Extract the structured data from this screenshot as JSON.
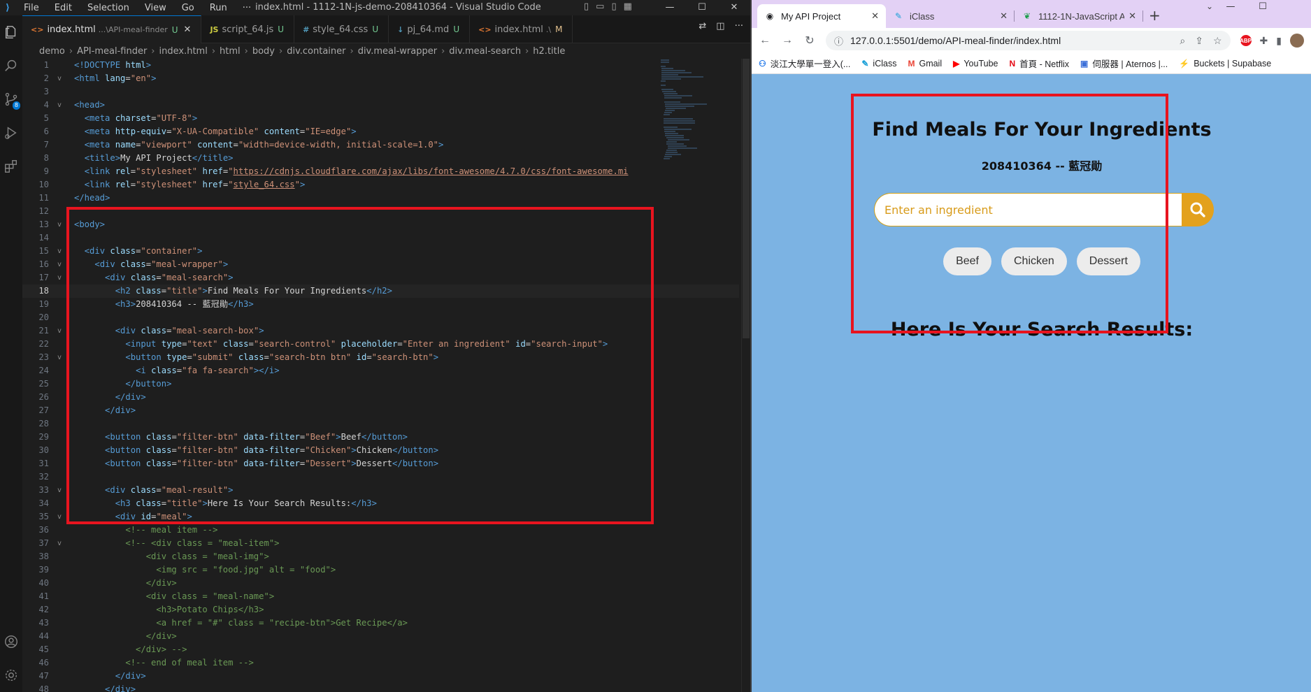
{
  "vscode": {
    "logo": "⟩",
    "menu": [
      "File",
      "Edit",
      "Selection",
      "View",
      "Go",
      "Run",
      "···"
    ],
    "window_title": "index.html - 1112-1N-js-demo-208410364 - Visual Studio Code",
    "source_control_badge": "8",
    "tabs": [
      {
        "icon": "<>",
        "label": "index.html",
        "desc": "...\\API-meal-finder",
        "status": "U",
        "kind": "html",
        "active": true
      },
      {
        "icon": "JS",
        "label": "script_64.js",
        "desc": "",
        "status": "U",
        "kind": "js",
        "active": false
      },
      {
        "icon": "#",
        "label": "style_64.css",
        "desc": "",
        "status": "U",
        "kind": "css",
        "active": false
      },
      {
        "icon": "↓",
        "label": "pj_64.md",
        "desc": "",
        "status": "U",
        "kind": "md",
        "active": false
      },
      {
        "icon": "<>",
        "label": "index.html",
        "desc": ".\\",
        "status": "M",
        "kind": "html",
        "active": false
      }
    ],
    "breadcrumb": [
      "demo",
      "API-meal-finder",
      "index.html",
      "html",
      "body",
      "div.container",
      "div.meal-wrapper",
      "div.meal-search",
      "h2.title"
    ],
    "current_line": 18,
    "code_lines": [
      {
        "n": 1,
        "fold": "",
        "html": "<span class=\"t\">&lt;!DOCTYPE</span> <span class=\"a\">html</span><span class=\"t\">&gt;</span>"
      },
      {
        "n": 2,
        "fold": "v",
        "html": "<span class=\"t\">&lt;html</span> <span class=\"a\">lang</span>=<span class=\"s\">\"en\"</span><span class=\"t\">&gt;</span>"
      },
      {
        "n": 3,
        "fold": "",
        "html": ""
      },
      {
        "n": 4,
        "fold": "v",
        "html": "<span class=\"t\">&lt;head&gt;</span>"
      },
      {
        "n": 5,
        "fold": "",
        "html": "  <span class=\"t\">&lt;meta</span> <span class=\"a\">charset</span>=<span class=\"s\">\"UTF-8\"</span><span class=\"t\">&gt;</span>"
      },
      {
        "n": 6,
        "fold": "",
        "html": "  <span class=\"t\">&lt;meta</span> <span class=\"a\">http-equiv</span>=<span class=\"s\">\"X-UA-Compatible\"</span> <span class=\"a\">content</span>=<span class=\"s\">\"IE=edge\"</span><span class=\"t\">&gt;</span>"
      },
      {
        "n": 7,
        "fold": "",
        "html": "  <span class=\"t\">&lt;meta</span> <span class=\"a\">name</span>=<span class=\"s\">\"viewport\"</span> <span class=\"a\">content</span>=<span class=\"s\">\"width=device-width, initial-scale=1.0\"</span><span class=\"t\">&gt;</span>"
      },
      {
        "n": 8,
        "fold": "",
        "html": "  <span class=\"t\">&lt;title&gt;</span>My API Project<span class=\"t\">&lt;/title&gt;</span>"
      },
      {
        "n": 9,
        "fold": "",
        "html": "  <span class=\"t\">&lt;link</span> <span class=\"a\">rel</span>=<span class=\"s\">\"stylesheet\"</span> <span class=\"a\">href</span>=<span class=\"s\">\"<span class=\"u\">https://cdnjs.cloudflare.com/ajax/libs/font-awesome/4.7.0/css/font-awesome.mi</span></span>"
      },
      {
        "n": 10,
        "fold": "",
        "html": "  <span class=\"t\">&lt;link</span> <span class=\"a\">rel</span>=<span class=\"s\">\"stylesheet\"</span> <span class=\"a\">href</span>=<span class=\"s\">\"<span class=\"u\">style_64.css</span>\"</span><span class=\"t\">&gt;</span>"
      },
      {
        "n": 11,
        "fold": "",
        "html": "<span class=\"t\">&lt;/head&gt;</span>"
      },
      {
        "n": 12,
        "fold": "",
        "html": ""
      },
      {
        "n": 13,
        "fold": "v",
        "html": "<span class=\"t\">&lt;body&gt;</span>"
      },
      {
        "n": 14,
        "fold": "",
        "html": ""
      },
      {
        "n": 15,
        "fold": "v",
        "html": "  <span class=\"t\">&lt;div</span> <span class=\"a\">class</span>=<span class=\"s\">\"container\"</span><span class=\"t\">&gt;</span>"
      },
      {
        "n": 16,
        "fold": "v",
        "html": "    <span class=\"t\">&lt;div</span> <span class=\"a\">class</span>=<span class=\"s\">\"meal-wrapper\"</span><span class=\"t\">&gt;</span>"
      },
      {
        "n": 17,
        "fold": "v",
        "html": "      <span class=\"t\">&lt;div</span> <span class=\"a\">class</span>=<span class=\"s\">\"meal-search\"</span><span class=\"t\">&gt;</span>"
      },
      {
        "n": 18,
        "fold": "",
        "html": "        <span class=\"t\">&lt;h2</span> <span class=\"a\">class</span>=<span class=\"s\">\"title\"</span><span class=\"t\">&gt;</span>Find Meals For Your Ingredients<span class=\"t\">&lt;/h2&gt;</span>"
      },
      {
        "n": 19,
        "fold": "",
        "html": "        <span class=\"t\">&lt;h3&gt;</span>208410364 -- 藍冠勛<span class=\"t\">&lt;/h3&gt;</span>"
      },
      {
        "n": 20,
        "fold": "",
        "html": ""
      },
      {
        "n": 21,
        "fold": "v",
        "html": "        <span class=\"t\">&lt;div</span> <span class=\"a\">class</span>=<span class=\"s\">\"meal-search-box\"</span><span class=\"t\">&gt;</span>"
      },
      {
        "n": 22,
        "fold": "",
        "html": "          <span class=\"t\">&lt;input</span> <span class=\"a\">type</span>=<span class=\"s\">\"text\"</span> <span class=\"a\">class</span>=<span class=\"s\">\"search-control\"</span> <span class=\"a\">placeholder</span>=<span class=\"s\">\"Enter an ingredient\"</span> <span class=\"a\">id</span>=<span class=\"s\">\"search-input\"</span><span class=\"t\">&gt;</span>"
      },
      {
        "n": 23,
        "fold": "v",
        "html": "          <span class=\"t\">&lt;button</span> <span class=\"a\">type</span>=<span class=\"s\">\"submit\"</span> <span class=\"a\">class</span>=<span class=\"s\">\"search-btn btn\"</span> <span class=\"a\">id</span>=<span class=\"s\">\"search-btn\"</span><span class=\"t\">&gt;</span>"
      },
      {
        "n": 24,
        "fold": "",
        "html": "            <span class=\"t\">&lt;i</span> <span class=\"a\">class</span>=<span class=\"s\">\"fa fa-search\"</span><span class=\"t\">&gt;&lt;/i&gt;</span>"
      },
      {
        "n": 25,
        "fold": "",
        "html": "          <span class=\"t\">&lt;/button&gt;</span>"
      },
      {
        "n": 26,
        "fold": "",
        "html": "        <span class=\"t\">&lt;/div&gt;</span>"
      },
      {
        "n": 27,
        "fold": "",
        "html": "      <span class=\"t\">&lt;/div&gt;</span>"
      },
      {
        "n": 28,
        "fold": "",
        "html": ""
      },
      {
        "n": 29,
        "fold": "",
        "html": "      <span class=\"t\">&lt;button</span> <span class=\"a\">class</span>=<span class=\"s\">\"filter-btn\"</span> <span class=\"a\">data-filter</span>=<span class=\"s\">\"Beef\"</span><span class=\"t\">&gt;</span>Beef<span class=\"t\">&lt;/button&gt;</span>"
      },
      {
        "n": 30,
        "fold": "",
        "html": "      <span class=\"t\">&lt;button</span> <span class=\"a\">class</span>=<span class=\"s\">\"filter-btn\"</span> <span class=\"a\">data-filter</span>=<span class=\"s\">\"Chicken\"</span><span class=\"t\">&gt;</span>Chicken<span class=\"t\">&lt;/button&gt;</span>"
      },
      {
        "n": 31,
        "fold": "",
        "html": "      <span class=\"t\">&lt;button</span> <span class=\"a\">class</span>=<span class=\"s\">\"filter-btn\"</span> <span class=\"a\">data-filter</span>=<span class=\"s\">\"Dessert\"</span><span class=\"t\">&gt;</span>Dessert<span class=\"t\">&lt;/button&gt;</span>"
      },
      {
        "n": 32,
        "fold": "",
        "html": ""
      },
      {
        "n": 33,
        "fold": "v",
        "html": "      <span class=\"t\">&lt;div</span> <span class=\"a\">class</span>=<span class=\"s\">\"meal-result\"</span><span class=\"t\">&gt;</span>"
      },
      {
        "n": 34,
        "fold": "",
        "html": "        <span class=\"t\">&lt;h3</span> <span class=\"a\">class</span>=<span class=\"s\">\"title\"</span><span class=\"t\">&gt;</span>Here Is Your Search Results:<span class=\"t\">&lt;/h3&gt;</span>"
      },
      {
        "n": 35,
        "fold": "v",
        "html": "        <span class=\"t\">&lt;div</span> <span class=\"a\">id</span>=<span class=\"s\">\"meal\"</span><span class=\"t\">&gt;</span>"
      },
      {
        "n": 36,
        "fold": "",
        "html": "          <span class=\"c\">&lt;!-- meal item --&gt;</span>"
      },
      {
        "n": 37,
        "fold": "v",
        "html": "          <span class=\"c\">&lt;!-- &lt;div class = \"meal-item\"&gt;</span>"
      },
      {
        "n": 38,
        "fold": "",
        "html": "<span class=\"c\">              &lt;div class = \"meal-img\"&gt;</span>"
      },
      {
        "n": 39,
        "fold": "",
        "html": "<span class=\"c\">                &lt;img src = \"food.jpg\" alt = \"food\"&gt;</span>"
      },
      {
        "n": 40,
        "fold": "",
        "html": "<span class=\"c\">              &lt;/div&gt;</span>"
      },
      {
        "n": 41,
        "fold": "",
        "html": "<span class=\"c\">              &lt;div class = \"meal-name\"&gt;</span>"
      },
      {
        "n": 42,
        "fold": "",
        "html": "<span class=\"c\">                &lt;h3&gt;Potato Chips&lt;/h3&gt;</span>"
      },
      {
        "n": 43,
        "fold": "",
        "html": "<span class=\"c\">                &lt;a href = \"#\" class = \"recipe-btn\"&gt;Get Recipe&lt;/a&gt;</span>"
      },
      {
        "n": 44,
        "fold": "",
        "html": "<span class=\"c\">              &lt;/div&gt;</span>"
      },
      {
        "n": 45,
        "fold": "",
        "html": "<span class=\"c\">            &lt;/div&gt; --&gt;</span>"
      },
      {
        "n": 46,
        "fold": "",
        "html": "          <span class=\"c\">&lt;!-- end of meal item --&gt;</span>"
      },
      {
        "n": 47,
        "fold": "",
        "html": "        <span class=\"t\">&lt;/div&gt;</span>"
      },
      {
        "n": 48,
        "fold": "",
        "html": "      <span class=\"t\">&lt;/div&gt;</span>"
      }
    ]
  },
  "chrome": {
    "tabs": [
      {
        "title": "My API Project",
        "icon": "globe-icon",
        "glyph": "◉",
        "active": true
      },
      {
        "title": "iClass",
        "icon": "iclass-icon",
        "glyph": "✎",
        "active": false
      },
      {
        "title": "1112-1N-JavaScript A",
        "icon": "evernote-icon",
        "glyph": "❦",
        "active": false
      }
    ],
    "url": "127.0.0.1:5501/demo/API-meal-finder/index.html",
    "bookmarks": [
      {
        "label": "淡江大學單一登入(...",
        "icon": "tku-icon",
        "glyph": "⚇",
        "color": "#1a73e8"
      },
      {
        "label": "iClass",
        "icon": "iclass-icon",
        "glyph": "✎",
        "color": "#1aa0d8"
      },
      {
        "label": "Gmail",
        "icon": "gmail-icon",
        "glyph": "M",
        "color": "#ea4335"
      },
      {
        "label": "YouTube",
        "icon": "youtube-icon",
        "glyph": "▶",
        "color": "#ff0000"
      },
      {
        "label": "首頁 - Netflix",
        "icon": "netflix-icon",
        "glyph": "N",
        "color": "#e50914"
      },
      {
        "label": "伺服器 | Aternos |...",
        "icon": "aternos-icon",
        "glyph": "▣",
        "color": "#3b6fd8"
      },
      {
        "label": "Buckets | Supabase",
        "icon": "supabase-icon",
        "glyph": "⚡",
        "color": "#1f9f6e"
      }
    ]
  },
  "page": {
    "title": "Find Meals For Your Ingredients",
    "subtitle": "208410364 -- 藍冠勛",
    "search_placeholder": "Enter an ingredient",
    "filters": [
      "Beef",
      "Chicken",
      "Dessert"
    ],
    "results_title": "Here Is Your Search Results:"
  },
  "colors": {
    "page_bg": "#7cb3e3",
    "search_button": "#e3a11d",
    "highlight_box": "#e8141f"
  }
}
